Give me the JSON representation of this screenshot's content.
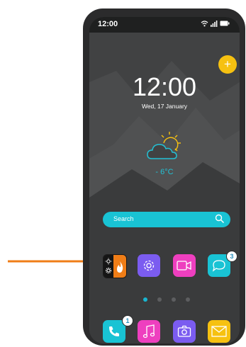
{
  "status": {
    "time": "12:00",
    "icons": [
      "wifi-icon",
      "signal-icon",
      "battery-icon"
    ]
  },
  "lockscreen": {
    "time": "12:00",
    "date": "Wed, 17 January",
    "temperature": "- 6°C"
  },
  "search": {
    "placeholder": "Search"
  },
  "apps": [
    {
      "name": "theme-toggle",
      "icon": "sun-flame-icon"
    },
    {
      "name": "settings",
      "icon": "gear-icon",
      "color": "#7b5cf0"
    },
    {
      "name": "video",
      "icon": "video-camera-icon",
      "color": "#ee3fbf"
    },
    {
      "name": "messages",
      "icon": "chat-bubble-icon",
      "color": "#19c3d4",
      "badge": "3"
    }
  ],
  "dock": [
    {
      "name": "phone",
      "icon": "phone-icon",
      "color": "#19c3d4",
      "badge": "1"
    },
    {
      "name": "music",
      "icon": "music-note-icon",
      "color": "#ee3fbf"
    },
    {
      "name": "camera",
      "icon": "camera-icon",
      "color": "#7b5cf0"
    },
    {
      "name": "mail",
      "icon": "mail-icon",
      "color": "#f6c111"
    }
  ],
  "page_indicator": {
    "total": 4,
    "active": 1
  },
  "colors": {
    "accent": "#19c3d4",
    "arrow": "#ef7d17",
    "frame": "#2b2b2c",
    "screen": "#414243"
  }
}
